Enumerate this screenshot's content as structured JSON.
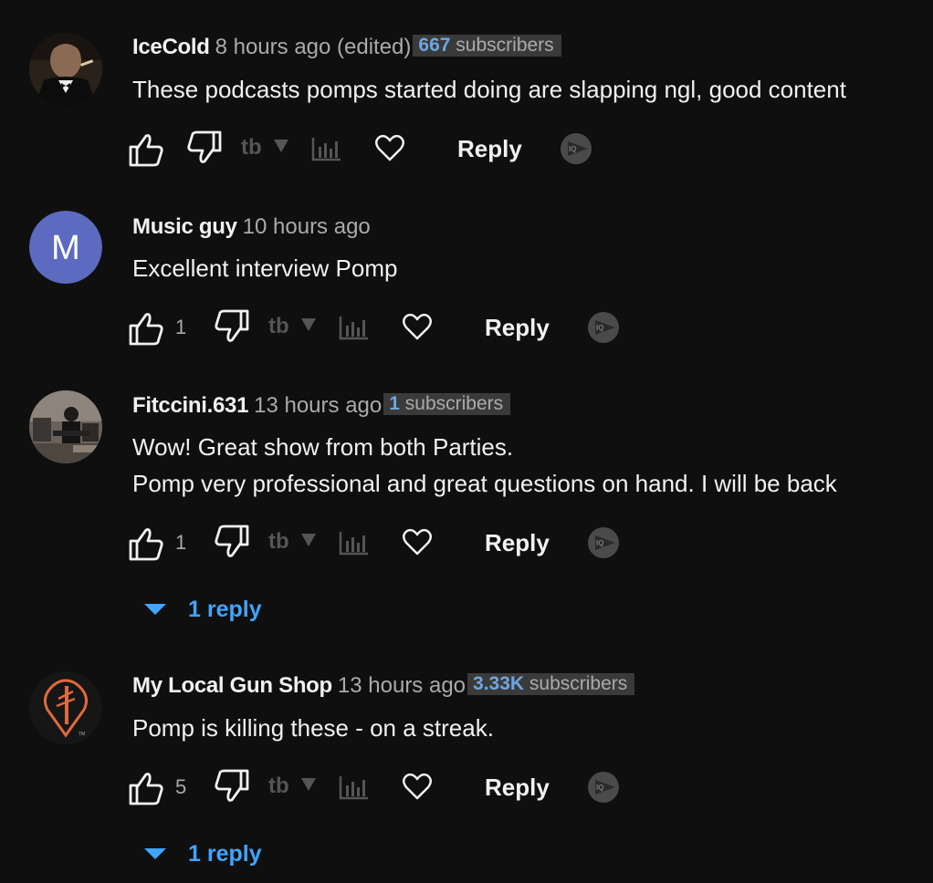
{
  "colors": {
    "background": "#0f0f0f",
    "text": "#f1f1f1",
    "muted": "#aaaaaa",
    "link_blue": "#3ea6ff",
    "subs_number": "#6ea6e0",
    "subs_badge_bg": "#3a3a3a"
  },
  "actions": {
    "reply_label": "Reply",
    "like_icon": "thumbs-up-icon",
    "dislike_icon": "thumbs-down-icon",
    "tb_icon": "tubebuddy-icon",
    "stats_icon": "bar-chart-icon",
    "heart_icon": "heart-icon",
    "ia_icon": "ia-play-icon"
  },
  "comments": [
    {
      "author": "IceCold",
      "time": "8 hours ago (edited)",
      "subs_num": "667",
      "subs_word": "subscribers",
      "lines": [
        "These podcasts pomps started doing are slapping ngl, good content"
      ],
      "likes": "",
      "avatar": "photo-man-in-tuxedo"
    },
    {
      "author": "Music guy",
      "time": "10 hours ago",
      "subs_num": "",
      "subs_word": "",
      "lines": [
        "Excellent interview Pomp"
      ],
      "likes": "1",
      "avatar": "letter-avatar",
      "avatar_letter": "M",
      "avatar_color": "#5c6bc0"
    },
    {
      "author": "Fitccini.631",
      "time": "13 hours ago",
      "subs_num": "1",
      "subs_word": "subscribers",
      "lines": [
        "Wow! Great show from both Parties.",
        "Pomp very professional and great questions on hand. I will be back"
      ],
      "likes": "1",
      "avatar": "photo-gym",
      "replies_label": "1 reply"
    },
    {
      "author": "My Local Gun Shop",
      "time": "13 hours ago",
      "subs_num": "3.33K",
      "subs_word": "subscribers",
      "lines": [
        "Pomp is killing these - on a streak."
      ],
      "likes": "5",
      "avatar": "orange-pin-logo",
      "replies_label": "1 reply"
    }
  ]
}
